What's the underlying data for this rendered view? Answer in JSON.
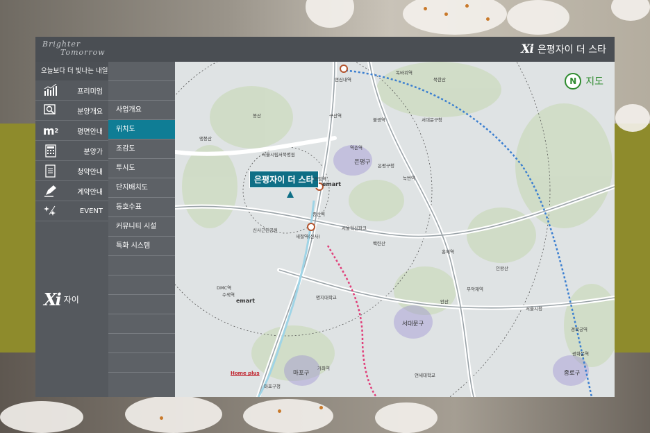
{
  "header": {
    "script_logo_line1": "Brighter",
    "script_logo_line2": "Tomorrow",
    "brand_mark": "Xi",
    "brand_title": "은평자이 더 스타"
  },
  "sidebar": {
    "tagline": "오늘보다 더 빛나는 내일",
    "items": [
      {
        "label": "프리미엄",
        "icon": "chart-icon"
      },
      {
        "label": "분양개요",
        "icon": "magnifier-icon"
      },
      {
        "label": "평면안내",
        "icon": "square-meter-icon"
      },
      {
        "label": "분양가",
        "icon": "calculator-icon"
      },
      {
        "label": "청약안내",
        "icon": "document-icon"
      },
      {
        "label": "계약안내",
        "icon": "pen-icon"
      },
      {
        "label": "EVENT",
        "icon": "sparkle-icon"
      }
    ],
    "footer_mark": "Xi",
    "footer_text": "자이"
  },
  "submenu": {
    "items": [
      {
        "label": "사업개요",
        "active": false
      },
      {
        "label": "위치도",
        "active": true
      },
      {
        "label": "조감도",
        "active": false
      },
      {
        "label": "투시도",
        "active": false
      },
      {
        "label": "단지배치도",
        "active": false
      },
      {
        "label": "동호수표",
        "active": false
      },
      {
        "label": "커뮤니티 시설",
        "active": false
      },
      {
        "label": "특화 시스템",
        "active": false
      }
    ]
  },
  "map": {
    "north_letter": "N",
    "north_label": "지도",
    "site_label": "은평자이 더 스타",
    "districts": [
      "은평구",
      "서대문구",
      "마포구",
      "종로구"
    ],
    "stations": [
      "연신내역",
      "구산역",
      "역촌역",
      "응암역",
      "새절역(신사)",
      "증산역",
      "불광역",
      "녹번역",
      "독바위역",
      "홍제역",
      "무악재역",
      "가좌역",
      "DMC역",
      "수색역",
      "경복궁역",
      "광화문역"
    ],
    "places": [
      "봉산",
      "앵봉산",
      "북한산",
      "백련산",
      "안산",
      "인왕산",
      "서울시립서북병원",
      "신사근린공원",
      "서울혁신파크",
      "명지대학교",
      "연세대학교",
      "서울시청",
      "은평구청",
      "서대문구청",
      "마포구청"
    ],
    "emart_labels": [
      "emart",
      "emart"
    ],
    "homeplus_label": "Home plus",
    "colors": {
      "active_menu": "#0f7d95",
      "site_label": "#0f6f86",
      "gtx_line": "#3b7fd0",
      "new_line": "#e0407a"
    }
  }
}
